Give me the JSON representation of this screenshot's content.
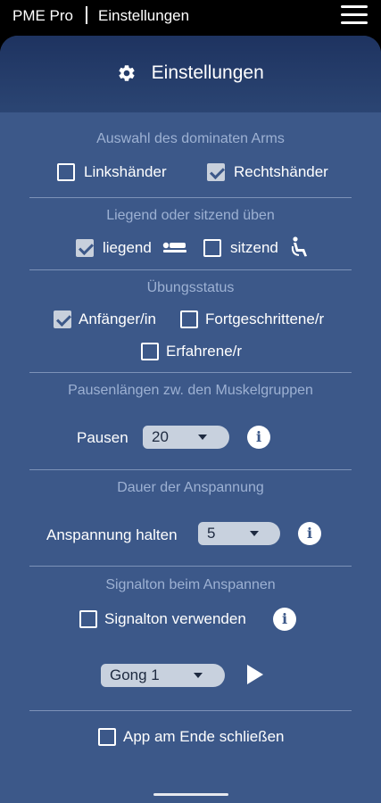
{
  "topbar": {
    "app_title": "PME Pro",
    "page_name": "Einstellungen",
    "menu_icon": "hamburger-menu-icon"
  },
  "header": {
    "icon": "gear-icon",
    "title": "Einstellungen"
  },
  "arm": {
    "title": "Auswahl des dominaten Arms",
    "options": [
      {
        "label": "Linkshänder",
        "checked": false
      },
      {
        "label": "Rechtshänder",
        "checked": true
      }
    ]
  },
  "position": {
    "title": "Liegend oder sitzend üben",
    "options": [
      {
        "label": "liegend",
        "checked": true,
        "icon": "lying-person-icon"
      },
      {
        "label": "sitzend",
        "checked": false,
        "icon": "sitting-person-icon"
      }
    ]
  },
  "status": {
    "title": "Übungsstatus",
    "options": [
      {
        "label": "Anfänger/in",
        "checked": true
      },
      {
        "label": "Fortgeschrittene/r",
        "checked": false
      },
      {
        "label": "Erfahrene/r",
        "checked": false
      }
    ]
  },
  "pauses": {
    "title": "Pausenlängen zw. den Muskelgruppen",
    "label": "Pausen",
    "value": "20"
  },
  "tension": {
    "title": "Dauer der Anspannung",
    "label": "Anspannung halten",
    "value": "5"
  },
  "signal": {
    "title": "Signalton beim Anspannen",
    "checkbox_label": "Signalton verwenden",
    "checked": false,
    "sound_value": "Gong 1"
  },
  "close_app": {
    "label": "App am Ende schließen",
    "checked": false
  },
  "colors": {
    "background": "#3c5889",
    "header": "#23396a",
    "section_title": "#9db1d3"
  }
}
